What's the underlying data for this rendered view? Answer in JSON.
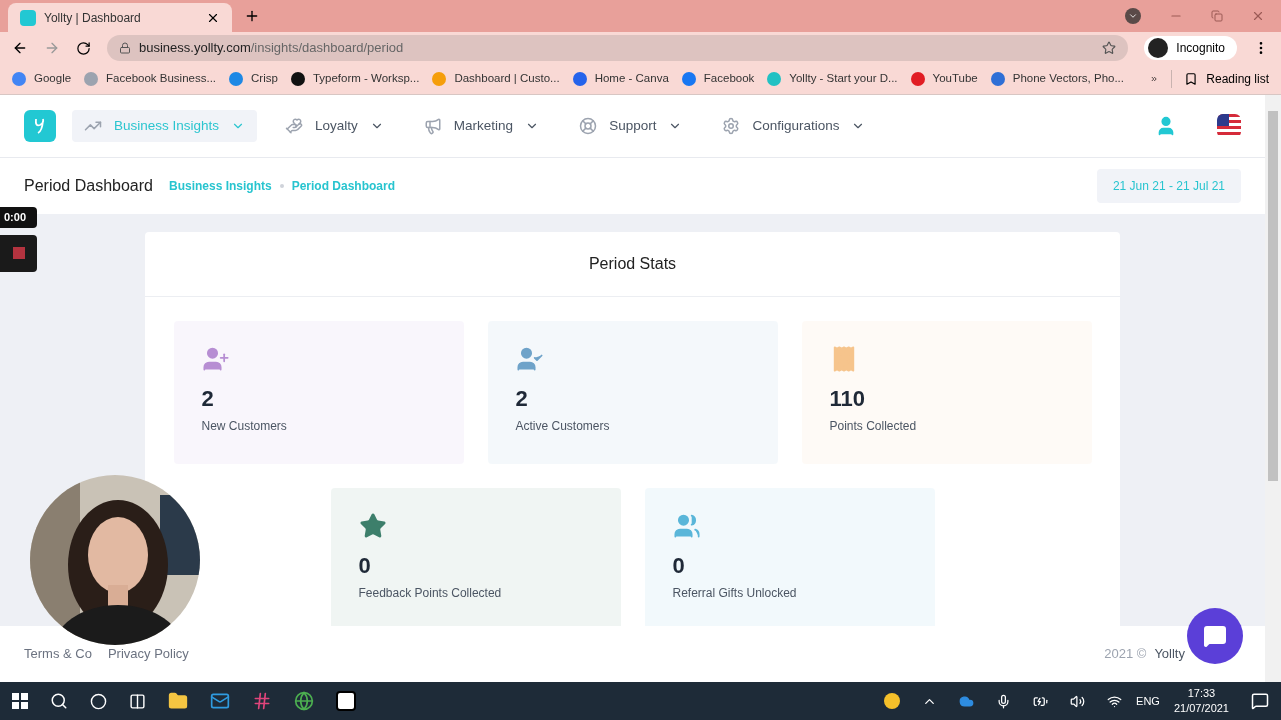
{
  "browser": {
    "tab_title": "Yollty | Dashboard",
    "url_host": "business.yollty.com",
    "url_path": "/insights/dashboard/period",
    "profile": "Incognito",
    "bookmarks": [
      "Google",
      "Facebook Business...",
      "Crisp",
      "Typeform - Worksp...",
      "Dashboard | Custo...",
      "Home - Canva",
      "Facebook",
      "Yollty - Start your D...",
      "YouTube",
      "Phone Vectors, Pho..."
    ],
    "reading_list": "Reading list"
  },
  "nav": {
    "items": [
      {
        "label": "Business Insights",
        "selected": true
      },
      {
        "label": "Loyalty",
        "selected": false
      },
      {
        "label": "Marketing",
        "selected": false
      },
      {
        "label": "Support",
        "selected": false
      },
      {
        "label": "Configurations",
        "selected": false
      }
    ]
  },
  "header": {
    "title": "Period Dashboard",
    "breadcrumb": [
      "Business Insights",
      "Period Dashboard"
    ],
    "date_range": "21 Jun 21 - 21 Jul 21"
  },
  "recorder": {
    "time": "0:00"
  },
  "stats": {
    "title": "Period Stats",
    "tiles": [
      {
        "kind": "new-customers",
        "value": "2",
        "label": "New Customers",
        "color": "#b78ed3"
      },
      {
        "kind": "active-customers",
        "value": "2",
        "label": "Active Customers",
        "color": "#6fa3c9"
      },
      {
        "kind": "points",
        "value": "110",
        "label": "Points Collected",
        "color": "#f6c48c"
      },
      {
        "kind": "feedback",
        "value": "0",
        "label": "Feedback Points Collected",
        "color": "#3d7f6b"
      },
      {
        "kind": "referral",
        "value": "0",
        "label": "Referral Gifts Unlocked",
        "color": "#5ab6d9"
      }
    ]
  },
  "footer": {
    "links": [
      "Terms & Co",
      "Privacy Policy"
    ],
    "copyright": "2021 ©",
    "brand": "Yollty"
  },
  "taskbar": {
    "language": "ENG",
    "time": "17:33",
    "date": "21/07/2021"
  }
}
